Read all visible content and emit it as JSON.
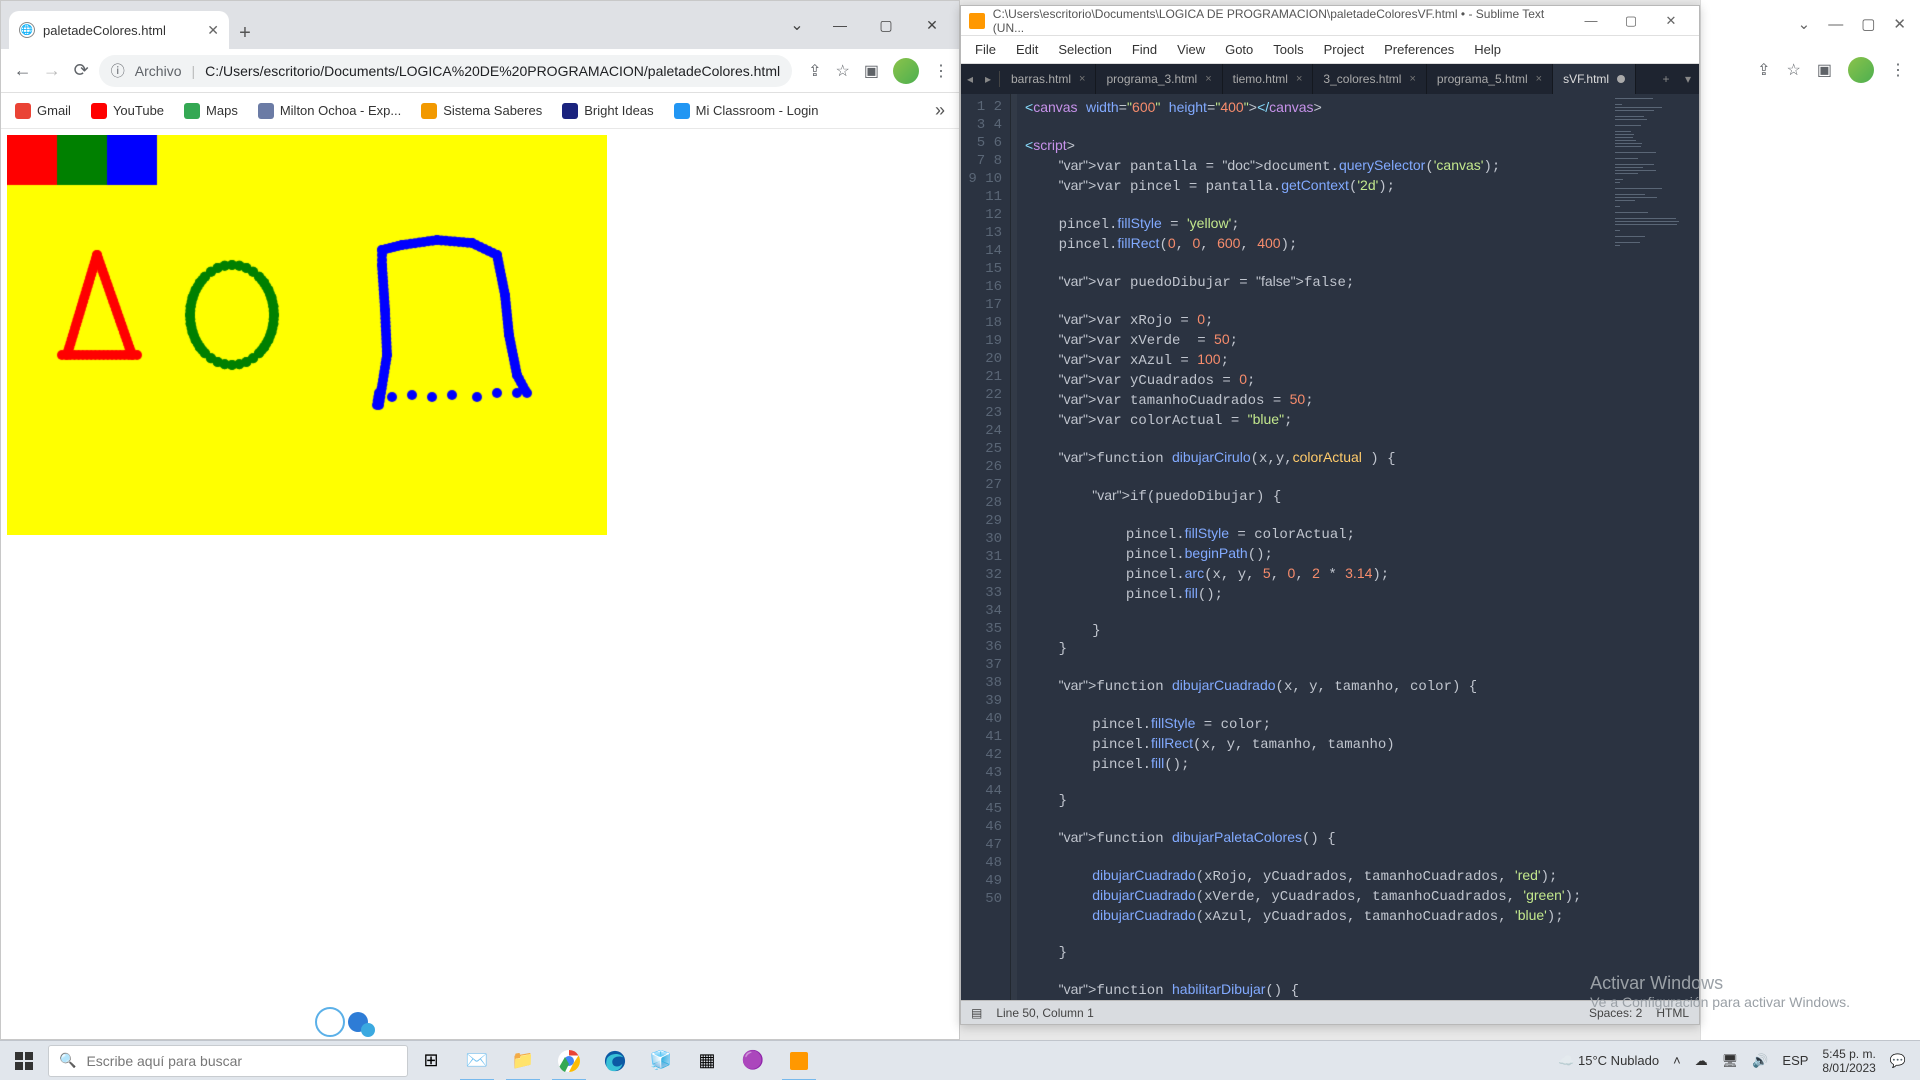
{
  "chrome": {
    "tab_title": "paletadeColores.html",
    "url_prefix": "Archivo",
    "url": "C:/Users/escritorio/Documents/LOGICA%20DE%20PROGRAMACION/paletadeColores.html",
    "bookmarks": [
      {
        "label": "Gmail",
        "color": "#ea4335"
      },
      {
        "label": "YouTube",
        "color": "#ff0000"
      },
      {
        "label": "Maps",
        "color": "#34a853"
      },
      {
        "label": "Milton Ochoa - Exp...",
        "color": "#6b7ba5"
      },
      {
        "label": "Sistema Saberes",
        "color": "#f29900"
      },
      {
        "label": "Bright Ideas",
        "color": "#1a237e"
      },
      {
        "label": "Mi Classroom - Login",
        "color": "#2196f3"
      }
    ]
  },
  "sublime": {
    "title_path": "C:\\Users\\escritorio\\Documents\\LOGICA DE PROGRAMACION\\paletadeColoresVF.html • - Sublime Text (UN...",
    "menu": [
      "File",
      "Edit",
      "Selection",
      "Find",
      "View",
      "Goto",
      "Tools",
      "Project",
      "Preferences",
      "Help"
    ],
    "tabs": [
      {
        "label": "barras.html",
        "active": false
      },
      {
        "label": "programa_3.html",
        "active": false
      },
      {
        "label": "tiemo.html",
        "active": false
      },
      {
        "label": "3_colores.html",
        "active": false
      },
      {
        "label": "programa_5.html",
        "active": false
      },
      {
        "label": "sVF.html",
        "active": true,
        "dirty": true
      }
    ],
    "status_left": "Line 50, Column 1",
    "status_spaces": "Spaces: 2",
    "status_lang": "HTML",
    "lines": 50
  },
  "code_plain": "<canvas width=\"600\" height=\"400\"></canvas>\n\n<script>\n    var pantalla = document.querySelector('canvas');\n    var pincel = pantalla.getContext('2d');\n\n    pincel.fillStyle = 'yellow';\n    pincel.fillRect(0, 0, 600, 400);\n\n    var puedoDibujar = false;\n\n    var xRojo = 0;\n    var xVerde  = 50;\n    var xAzul = 100;\n    var yCuadrados = 0;\n    var tamanhoCuadrados = 50;\n    var colorActual = \"blue\";\n\n    function dibujarCirulo(x,y,colorActual ) {\n\n        if(puedoDibujar) {\n\n            pincel.fillStyle = colorActual;\n            pincel.beginPath();\n            pincel.arc(x, y, 5, 0, 2 * 3.14);\n            pincel.fill();\n\n        }\n    }\n\n    function dibujarCuadrado(x, y, tamanho, color) {\n\n        pincel.fillStyle = color;\n        pincel.fillRect(x, y, tamanho, tamanho)\n        pincel.fill();\n\n    }\n\n    function dibujarPaletaColores() {\n\n        dibujarCuadrado(xRojo, yCuadrados, tamanhoCuadrados, 'red');\n        dibujarCuadrado(xVerde, yCuadrados, tamanhoCuadrados, 'green');\n        dibujarCuadrado(xAzul, yCuadrados, tamanhoCuadrados, 'blue');\n\n    }\n\n    function habilitarDibujar() {\n\n        puedoDibujar = true;\n    }",
  "watermark": {
    "l1": "Activar Windows",
    "l2": "Ve a Configuración para activar Windows."
  },
  "taskbar": {
    "search_placeholder": "Escribe aquí para buscar",
    "weather": "15°C  Nublado",
    "time": "5:45 p. m.",
    "date": "8/01/2023",
    "lang": "ESP"
  }
}
